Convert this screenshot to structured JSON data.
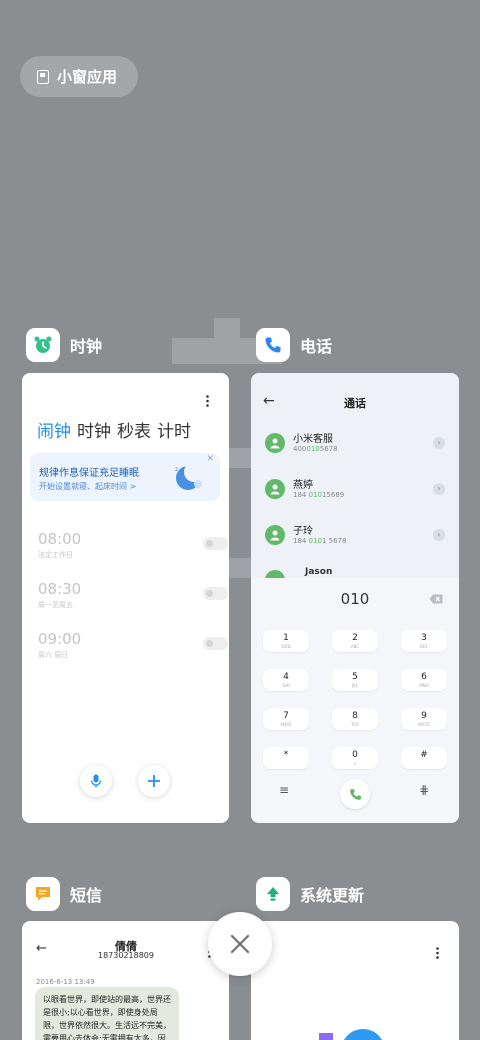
{
  "floating_window": {
    "label": "小窗应用"
  },
  "apps": {
    "clock": {
      "name": "时钟",
      "tabs": [
        "闹钟",
        "时钟",
        "秒表",
        "计时"
      ],
      "banner": {
        "title": "规律作息保证充足睡眠",
        "subtitle": "开始设置就寝、起床时间 >",
        "close": "✕"
      },
      "alarms": [
        {
          "time": "08:00",
          "repeat": "法定工作日",
          "enabled": false
        },
        {
          "time": "08:30",
          "repeat": "周一至周五",
          "enabled": false
        },
        {
          "time": "09:00",
          "repeat": "周六 周日",
          "enabled": false
        }
      ]
    },
    "phone": {
      "name": "电话",
      "title": "通话",
      "back": "←",
      "contacts": [
        {
          "name": "小米客服",
          "num_pre": "400",
          "num_hl": "010",
          "num_post": "5678"
        },
        {
          "name": "燕婷",
          "num_pre": "184 ",
          "num_hl": "010",
          "num_post": "15689"
        },
        {
          "name": "子玲",
          "num_pre": "184 ",
          "num_hl": "010",
          "num_post": "1 5678"
        }
      ],
      "partial_contact": "Jason",
      "dial_input": "010",
      "keys": [
        {
          "main": "1",
          "sub": "GQD"
        },
        {
          "main": "2",
          "sub": "ABC"
        },
        {
          "main": "3",
          "sub": "DEF"
        },
        {
          "main": "4",
          "sub": "GHI"
        },
        {
          "main": "5",
          "sub": "JKL"
        },
        {
          "main": "6",
          "sub": "MNO"
        },
        {
          "main": "7",
          "sub": "PQRS"
        },
        {
          "main": "8",
          "sub": "TUV"
        },
        {
          "main": "9",
          "sub": "WXYZ"
        },
        {
          "main": "*",
          "sub": ""
        },
        {
          "main": "0",
          "sub": "+"
        },
        {
          "main": "#",
          "sub": ""
        }
      ],
      "menu_glyph": "≡",
      "dialpad_glyph": "⋕"
    },
    "sms": {
      "name": "短信",
      "back": "←",
      "contact_name": "倩倩",
      "contact_number": "18730218809",
      "timestamp": "2016-6-13 13:49",
      "message": "以眼看世界，即使站的最高，世界还是很小;以心看世界，即使身处局限，世界依然很大。生活远不完美，需要用心去体会;无需拥有太多，因"
    },
    "update": {
      "name": "系统更新"
    }
  },
  "colors": {
    "background": "#8b8e91",
    "clock_accent": "#1f8ef1",
    "clock_icon": "#35c08a",
    "phone_icon": "#2f86f3",
    "contact_green": "#62b86b",
    "sms_icon": "#f5a623",
    "update_icon": "#20b07a"
  }
}
